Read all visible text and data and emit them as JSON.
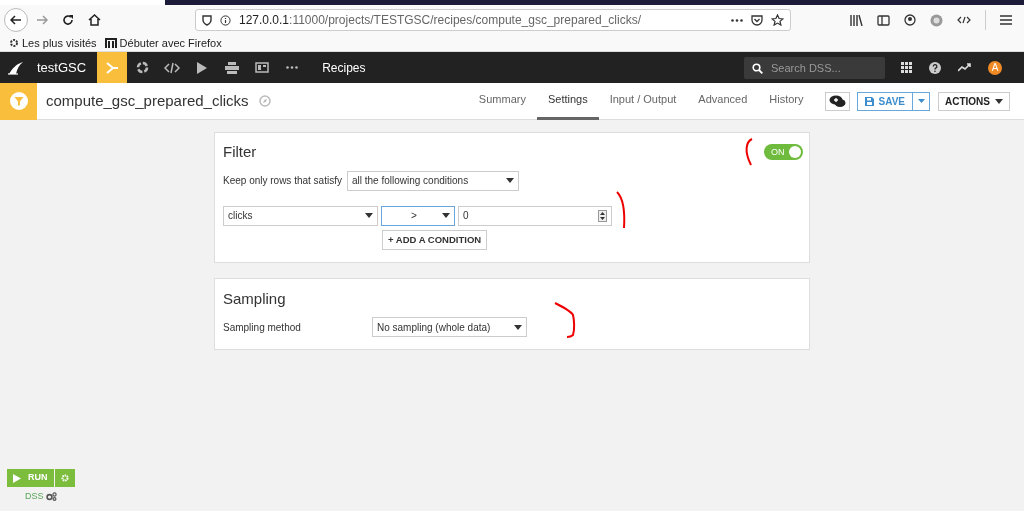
{
  "browser": {
    "url_host": "127.0.0.1",
    "url_rest": ":11000/projects/TESTGSC/recipes/compute_gsc_prepared_clicks/",
    "bookmarks": [
      "Les plus visités",
      "Débuter avec Firefox"
    ]
  },
  "topnav": {
    "project": "testGSC",
    "icons": [
      {
        "kind": "flow",
        "selected": true
      },
      {
        "kind": "cycle",
        "selected": false
      },
      {
        "kind": "code",
        "selected": false
      },
      {
        "kind": "play",
        "selected": false
      },
      {
        "kind": "stack",
        "selected": false
      },
      {
        "kind": "dashboard",
        "selected": false
      },
      {
        "kind": "more",
        "selected": false
      }
    ],
    "section": "Recipes",
    "search": {
      "placeholder": "Search DSS..."
    },
    "avatar": "A"
  },
  "recipe": {
    "name": "compute_gsc_prepared_clicks",
    "tabs": [
      {
        "label": "Summary",
        "selected": false
      },
      {
        "label": "Settings",
        "selected": true
      },
      {
        "label": "Input / Output",
        "selected": false
      },
      {
        "label": "Advanced",
        "selected": false
      },
      {
        "label": "History",
        "selected": false
      }
    ],
    "save": "SAVE",
    "actions": "ACTIONS"
  },
  "filter": {
    "title": "Filter",
    "on": true,
    "toggle_label": "ON",
    "keep_label": "Keep only rows that satisfy",
    "mode": "all the following conditions",
    "conditions": [
      {
        "column": "clicks",
        "operator": ">",
        "value": "0"
      }
    ],
    "add": "+ ADD A CONDITION"
  },
  "sampling": {
    "title": "Sampling",
    "label": "Sampling method",
    "method": "No sampling (whole data)"
  },
  "run": {
    "label": "RUN",
    "engine": "DSS"
  }
}
